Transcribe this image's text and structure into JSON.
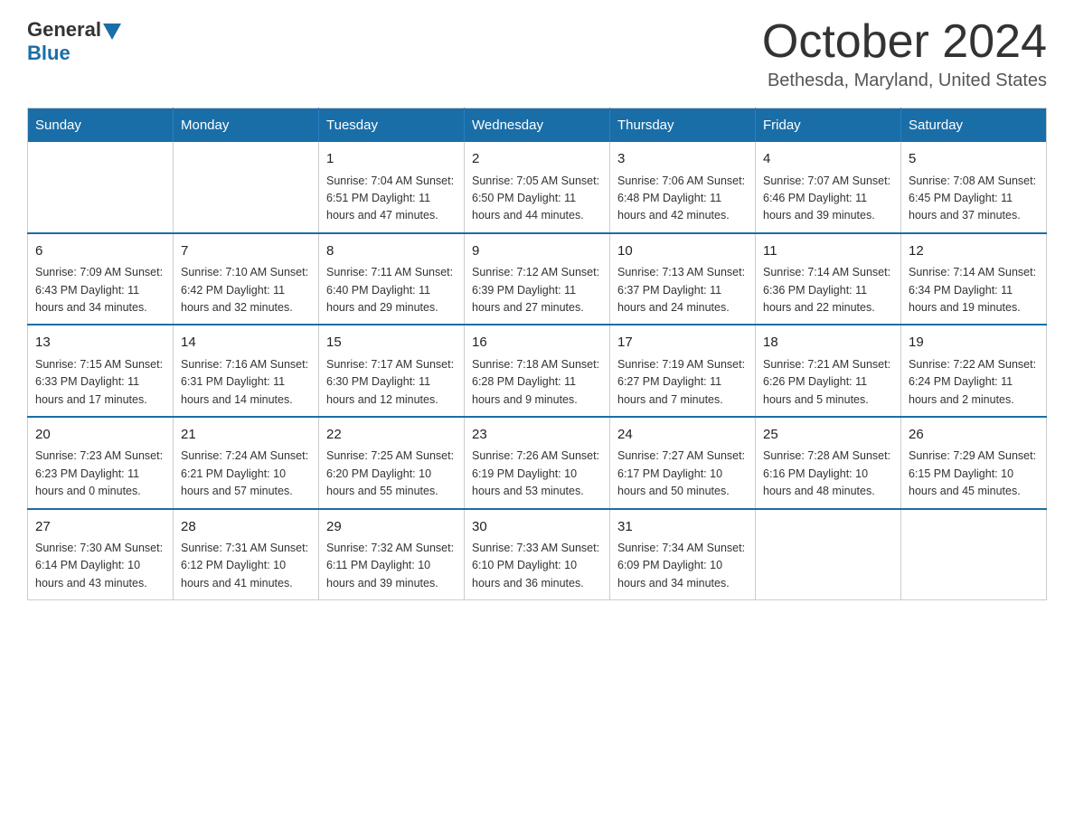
{
  "logo": {
    "general": "General",
    "blue": "Blue"
  },
  "header": {
    "month": "October 2024",
    "location": "Bethesda, Maryland, United States"
  },
  "days_of_week": [
    "Sunday",
    "Monday",
    "Tuesday",
    "Wednesday",
    "Thursday",
    "Friday",
    "Saturday"
  ],
  "weeks": [
    [
      {
        "day": "",
        "info": ""
      },
      {
        "day": "",
        "info": ""
      },
      {
        "day": "1",
        "info": "Sunrise: 7:04 AM\nSunset: 6:51 PM\nDaylight: 11 hours\nand 47 minutes."
      },
      {
        "day": "2",
        "info": "Sunrise: 7:05 AM\nSunset: 6:50 PM\nDaylight: 11 hours\nand 44 minutes."
      },
      {
        "day": "3",
        "info": "Sunrise: 7:06 AM\nSunset: 6:48 PM\nDaylight: 11 hours\nand 42 minutes."
      },
      {
        "day": "4",
        "info": "Sunrise: 7:07 AM\nSunset: 6:46 PM\nDaylight: 11 hours\nand 39 minutes."
      },
      {
        "day": "5",
        "info": "Sunrise: 7:08 AM\nSunset: 6:45 PM\nDaylight: 11 hours\nand 37 minutes."
      }
    ],
    [
      {
        "day": "6",
        "info": "Sunrise: 7:09 AM\nSunset: 6:43 PM\nDaylight: 11 hours\nand 34 minutes."
      },
      {
        "day": "7",
        "info": "Sunrise: 7:10 AM\nSunset: 6:42 PM\nDaylight: 11 hours\nand 32 minutes."
      },
      {
        "day": "8",
        "info": "Sunrise: 7:11 AM\nSunset: 6:40 PM\nDaylight: 11 hours\nand 29 minutes."
      },
      {
        "day": "9",
        "info": "Sunrise: 7:12 AM\nSunset: 6:39 PM\nDaylight: 11 hours\nand 27 minutes."
      },
      {
        "day": "10",
        "info": "Sunrise: 7:13 AM\nSunset: 6:37 PM\nDaylight: 11 hours\nand 24 minutes."
      },
      {
        "day": "11",
        "info": "Sunrise: 7:14 AM\nSunset: 6:36 PM\nDaylight: 11 hours\nand 22 minutes."
      },
      {
        "day": "12",
        "info": "Sunrise: 7:14 AM\nSunset: 6:34 PM\nDaylight: 11 hours\nand 19 minutes."
      }
    ],
    [
      {
        "day": "13",
        "info": "Sunrise: 7:15 AM\nSunset: 6:33 PM\nDaylight: 11 hours\nand 17 minutes."
      },
      {
        "day": "14",
        "info": "Sunrise: 7:16 AM\nSunset: 6:31 PM\nDaylight: 11 hours\nand 14 minutes."
      },
      {
        "day": "15",
        "info": "Sunrise: 7:17 AM\nSunset: 6:30 PM\nDaylight: 11 hours\nand 12 minutes."
      },
      {
        "day": "16",
        "info": "Sunrise: 7:18 AM\nSunset: 6:28 PM\nDaylight: 11 hours\nand 9 minutes."
      },
      {
        "day": "17",
        "info": "Sunrise: 7:19 AM\nSunset: 6:27 PM\nDaylight: 11 hours\nand 7 minutes."
      },
      {
        "day": "18",
        "info": "Sunrise: 7:21 AM\nSunset: 6:26 PM\nDaylight: 11 hours\nand 5 minutes."
      },
      {
        "day": "19",
        "info": "Sunrise: 7:22 AM\nSunset: 6:24 PM\nDaylight: 11 hours\nand 2 minutes."
      }
    ],
    [
      {
        "day": "20",
        "info": "Sunrise: 7:23 AM\nSunset: 6:23 PM\nDaylight: 11 hours\nand 0 minutes."
      },
      {
        "day": "21",
        "info": "Sunrise: 7:24 AM\nSunset: 6:21 PM\nDaylight: 10 hours\nand 57 minutes."
      },
      {
        "day": "22",
        "info": "Sunrise: 7:25 AM\nSunset: 6:20 PM\nDaylight: 10 hours\nand 55 minutes."
      },
      {
        "day": "23",
        "info": "Sunrise: 7:26 AM\nSunset: 6:19 PM\nDaylight: 10 hours\nand 53 minutes."
      },
      {
        "day": "24",
        "info": "Sunrise: 7:27 AM\nSunset: 6:17 PM\nDaylight: 10 hours\nand 50 minutes."
      },
      {
        "day": "25",
        "info": "Sunrise: 7:28 AM\nSunset: 6:16 PM\nDaylight: 10 hours\nand 48 minutes."
      },
      {
        "day": "26",
        "info": "Sunrise: 7:29 AM\nSunset: 6:15 PM\nDaylight: 10 hours\nand 45 minutes."
      }
    ],
    [
      {
        "day": "27",
        "info": "Sunrise: 7:30 AM\nSunset: 6:14 PM\nDaylight: 10 hours\nand 43 minutes."
      },
      {
        "day": "28",
        "info": "Sunrise: 7:31 AM\nSunset: 6:12 PM\nDaylight: 10 hours\nand 41 minutes."
      },
      {
        "day": "29",
        "info": "Sunrise: 7:32 AM\nSunset: 6:11 PM\nDaylight: 10 hours\nand 39 minutes."
      },
      {
        "day": "30",
        "info": "Sunrise: 7:33 AM\nSunset: 6:10 PM\nDaylight: 10 hours\nand 36 minutes."
      },
      {
        "day": "31",
        "info": "Sunrise: 7:34 AM\nSunset: 6:09 PM\nDaylight: 10 hours\nand 34 minutes."
      },
      {
        "day": "",
        "info": ""
      },
      {
        "day": "",
        "info": ""
      }
    ]
  ]
}
